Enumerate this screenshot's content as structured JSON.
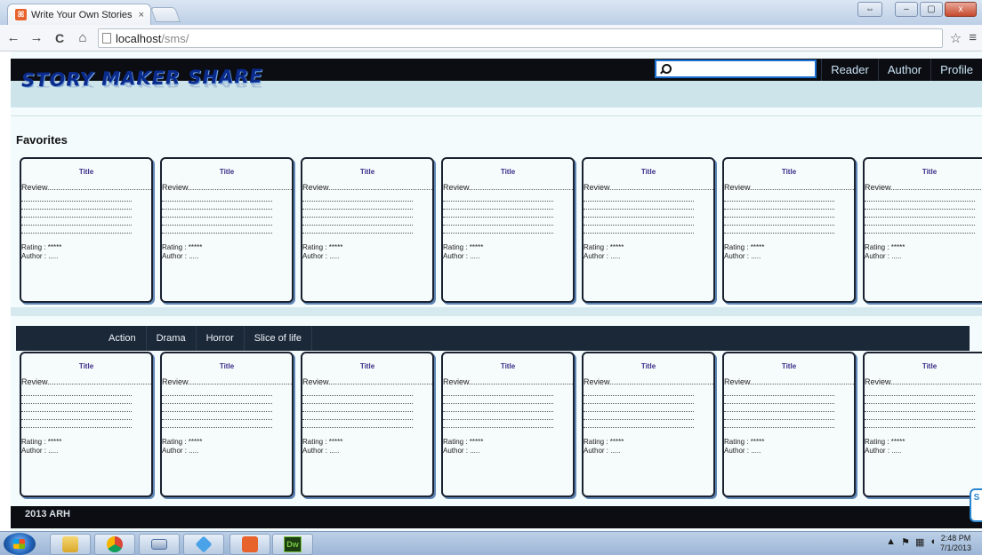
{
  "browser": {
    "tab_title": "Write Your Own Stories or",
    "tab_close": "×",
    "url_host": "localhost",
    "url_path": "/sms/",
    "window_buttons": [
      "⇔",
      "–",
      "▢",
      "x"
    ],
    "nav_back": "←",
    "nav_forward": "→",
    "nav_reload": "C",
    "nav_home": "⌂",
    "star": "☆",
    "menu": "≡"
  },
  "site": {
    "logo_text": "STORY MAKER SHARE",
    "search": {
      "value": "",
      "placeholder": ""
    },
    "nav_links": [
      "Reader",
      "Author",
      "Profile"
    ]
  },
  "favorites": {
    "heading": "Favorites",
    "cards": [
      {
        "title": "Title",
        "review": "Review...............................................",
        "rating": "Rating : *****",
        "author": "Author : ....."
      },
      {
        "title": "Title",
        "review": "Review...............................................",
        "rating": "Rating : *****",
        "author": "Author : ....."
      },
      {
        "title": "Title",
        "review": "Review...............................................",
        "rating": "Rating : *****",
        "author": "Author : ....."
      },
      {
        "title": "Title",
        "review": "Review...............................................",
        "rating": "Rating : *****",
        "author": "Author : ....."
      },
      {
        "title": "Title",
        "review": "Review...............................................",
        "rating": "Rating : *****",
        "author": "Author : ....."
      },
      {
        "title": "Title",
        "review": "Review...............................................",
        "rating": "Rating : *****",
        "author": "Author : ....."
      },
      {
        "title": "Title",
        "review": "Review...............................................",
        "rating": "Rating : *****",
        "author": "Author : ....."
      }
    ]
  },
  "genres": {
    "tabs": [
      "Action",
      "Drama",
      "Horror",
      "Slice of life"
    ],
    "cards": [
      {
        "title": "Title",
        "review": "Review...............................................",
        "rating": "Rating : *****",
        "author": "Author : ....."
      },
      {
        "title": "Title",
        "review": "Review...............................................",
        "rating": "Rating : *****",
        "author": "Author : ....."
      },
      {
        "title": "Title",
        "review": "Review...............................................",
        "rating": "Rating : *****",
        "author": "Author : ....."
      },
      {
        "title": "Title",
        "review": "Review...............................................",
        "rating": "Rating : *****",
        "author": "Author : ....."
      },
      {
        "title": "Title",
        "review": "Review...............................................",
        "rating": "Rating : *****",
        "author": "Author : ....."
      },
      {
        "title": "Title",
        "review": "Review...............................................",
        "rating": "Rating : *****",
        "author": "Author : ....."
      },
      {
        "title": "Title",
        "review": "Review...............................................",
        "rating": "Rating : *****",
        "author": "Author : ....."
      }
    ]
  },
  "footer": {
    "text": "2013 ARH"
  },
  "taskbar": {
    "apps": [
      "windows-explorer",
      "chrome",
      "keyboard",
      "dropbox",
      "xampp",
      "dreamweaver"
    ],
    "dreamweaver_label": "Dw",
    "time": "2:48 PM",
    "date": "7/1/2013"
  },
  "colors": {
    "topbar": "#0b0d12",
    "banner": "#cde5ea",
    "card_title": "#3b2e88",
    "genre_bar": "#1b2838",
    "search_border": "#1a6fd0"
  }
}
